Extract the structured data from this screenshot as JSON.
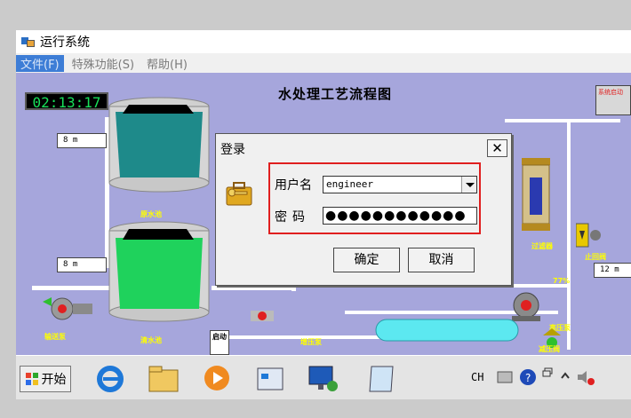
{
  "window": {
    "title": "运行系统"
  },
  "menu": {
    "items": [
      "文件(F)",
      "特殊功能(S)",
      "帮助(H)"
    ]
  },
  "hmi": {
    "clock": "02:13:17",
    "title": "水处理工艺流程图",
    "level_1": "8   m",
    "level_2": "8   m",
    "level_3": "12  m",
    "labels": {
      "tank1": "原水池",
      "tank2": "清水池",
      "pump_left": "输送泵",
      "filter": "过滤器",
      "high_pump": "高压泵",
      "check_valve": "止回阀",
      "boost_pump": "增压泵",
      "pressure_valve": "减压阀",
      "box": "启动",
      "side_btn": "系统启动",
      "pct": "77%"
    }
  },
  "dialog": {
    "title": "登录",
    "close": "✕",
    "username_label": "用户名",
    "username_value": "engineer",
    "password_label": "密码",
    "password_value": "●●●●●●●●●●●●",
    "ok": "确定",
    "cancel": "取消"
  },
  "taskbar": {
    "start": "开始",
    "lang": "CH"
  },
  "colors": {
    "canvas": "#a6a6dc",
    "highlight": "#e01f1f",
    "menu_active": "#3d7dd6"
  }
}
